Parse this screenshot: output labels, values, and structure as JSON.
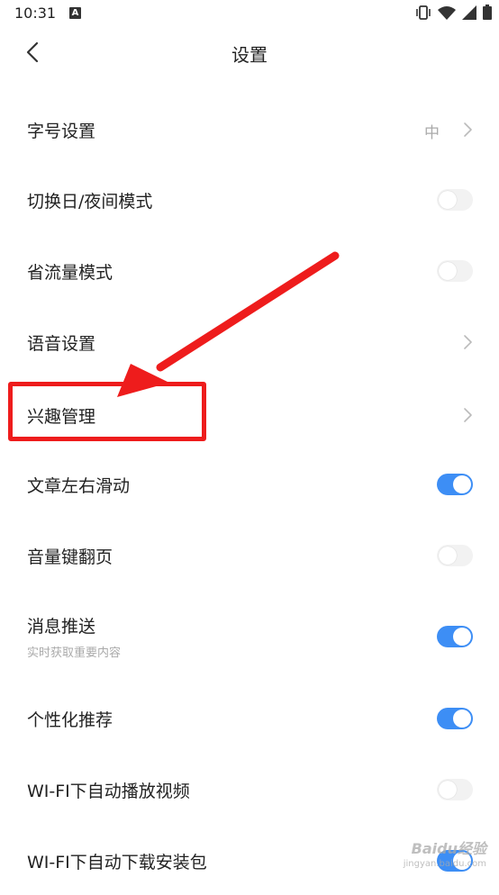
{
  "status_bar": {
    "time": "10:31",
    "app_icon_letter": "A"
  },
  "header": {
    "title": "设置",
    "back_icon": "chevron-left-icon"
  },
  "settings": [
    {
      "label": "字号设置",
      "value": "中",
      "control": "chevron"
    },
    {
      "label": "切换日/夜间模式",
      "control": "toggle",
      "on": false
    },
    {
      "label": "省流量模式",
      "control": "toggle",
      "on": false
    },
    {
      "label": "语音设置",
      "control": "chevron"
    },
    {
      "label": "兴趣管理",
      "control": "chevron",
      "highlighted": true
    },
    {
      "label": "文章左右滑动",
      "control": "toggle",
      "on": true
    },
    {
      "label": "音量键翻页",
      "control": "toggle",
      "on": false
    },
    {
      "label": "消息推送",
      "sublabel": "实时获取重要内容",
      "control": "toggle",
      "on": true
    },
    {
      "label": "个性化推荐",
      "control": "toggle",
      "on": true
    },
    {
      "label": "WI-FI下自动播放视频",
      "control": "toggle",
      "on": false
    },
    {
      "label": "WI-FI下自动下载安装包",
      "control": "toggle",
      "on": true
    }
  ],
  "annotation": {
    "color": "#ee1c1c"
  },
  "watermark": {
    "brand": "Baidu经验",
    "url": "jingyan.baidu.com"
  },
  "colors": {
    "toggle_on": "#3d8ef5",
    "toggle_off": "#f2f2f2",
    "text": "#222222",
    "secondary": "#aaaaaa"
  }
}
